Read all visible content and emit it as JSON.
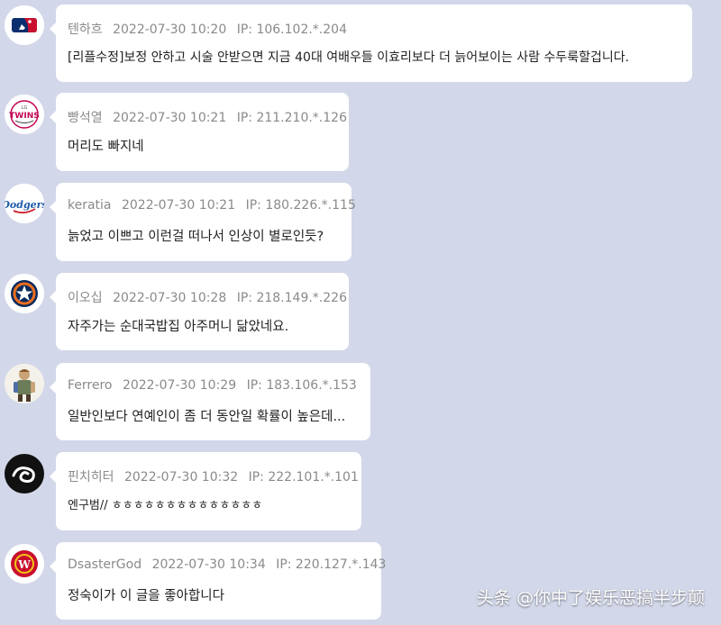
{
  "comments": [
    {
      "user": "텐하흐",
      "date": "2022-07-30 10:20",
      "ip": "IP: 106.102.*.204",
      "text": "[리플수정]보정 안하고 시술 안받으면 지금 40대 여배우들 이효리보다 더 늙어보이는 사람 수두룩할겁니다.",
      "avatar": "mlb-logo-icon"
    },
    {
      "user": "빵석열",
      "date": "2022-07-30 10:21",
      "ip": "IP: 211.210.*.126",
      "text": "머리도 빠지네",
      "avatar": "twins-logo-icon"
    },
    {
      "user": "keratia",
      "date": "2022-07-30 10:21",
      "ip": "IP: 180.226.*.115",
      "text": "늙었고 이쁘고 이런걸 떠나서 인상이 별로인듯?",
      "avatar": "dodgers-logo-icon"
    },
    {
      "user": "이오십",
      "date": "2022-07-30 10:28",
      "ip": "IP: 218.149.*.226",
      "text": "자주가는 순대국밥집 아주머니 닮았네요.",
      "avatar": "astros-logo-icon"
    },
    {
      "user": "Ferrero",
      "date": "2022-07-30 10:29",
      "ip": "IP: 183.106.*.153",
      "text": "일반인보다 연예인이 좀 더 동안일 확률이 높은데...",
      "avatar": "character-avatar-icon"
    },
    {
      "user": "핀치히터",
      "date": "2022-07-30 10:32",
      "ip": "IP: 222.101.*.101",
      "text": "엔구범// ㅎㅎㅎㅎㅎㅎㅎㅎㅎㅎㅎㅎㅎㅎ",
      "avatar": "black-swirl-logo-icon"
    },
    {
      "user": "DsasterGod",
      "date": "2022-07-30 10:34",
      "ip": "IP: 220.127.*.143",
      "text": "정숙이가 이 글을 좋아합니다",
      "avatar": "red-w-logo-icon"
    }
  ],
  "watermark": "头条 @你中了娱乐恶搞半步颠",
  "colors": {
    "background": "#d2d7e9",
    "bubble": "#ffffff",
    "meta": "#8a8a8a",
    "text": "#222222"
  }
}
